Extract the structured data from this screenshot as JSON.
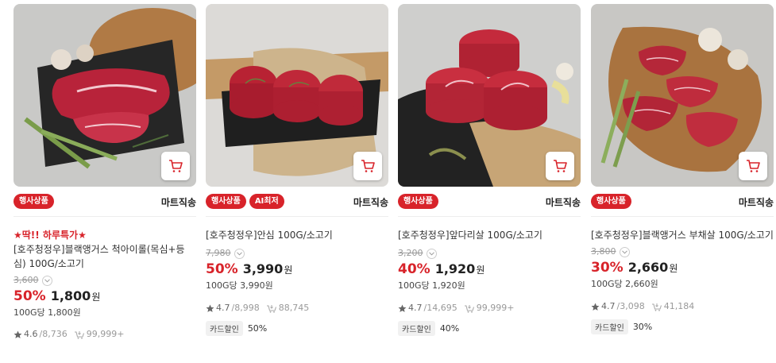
{
  "products": [
    {
      "badges": [
        "행사상품"
      ],
      "mart_label": "마트직송",
      "promo": "★딱!! 하루특가★",
      "title": "[호주청정우]블랙앵거스 척아이롤(목심+등심) 100G/소고기",
      "original_price": "3,600",
      "discount": "50%",
      "price": "1,800",
      "won": "원",
      "unit_price": "100G당 1,800원",
      "rating": "4.6",
      "reviews": "/8,736",
      "purchases": "99,999+",
      "card_discount_label": "",
      "card_discount_value": ""
    },
    {
      "badges": [
        "행사상품",
        "AI최저"
      ],
      "mart_label": "마트직송",
      "promo": "",
      "title": "[호주청정우]안심 100G/소고기",
      "original_price": "7,980",
      "discount": "50%",
      "price": "3,990",
      "won": "원",
      "unit_price": "100G당 3,990원",
      "rating": "4.7",
      "reviews": "/8,998",
      "purchases": "88,745",
      "card_discount_label": "카드할인",
      "card_discount_value": "50%"
    },
    {
      "badges": [
        "행사상품"
      ],
      "mart_label": "마트직송",
      "promo": "",
      "title": "[호주청정우]앞다리살 100G/소고기",
      "original_price": "3,200",
      "discount": "40%",
      "price": "1,920",
      "won": "원",
      "unit_price": "100G당 1,920원",
      "rating": "4.7",
      "reviews": "/14,695",
      "purchases": "99,999+",
      "card_discount_label": "카드할인",
      "card_discount_value": "40%"
    },
    {
      "badges": [
        "행사상품"
      ],
      "mart_label": "마트직송",
      "promo": "",
      "title": "[호주청정우]블랙앵거스 부채살 100G/소고기",
      "original_price": "3,800",
      "discount": "30%",
      "price": "2,660",
      "won": "원",
      "unit_price": "100G당 2,660원",
      "rating": "4.7",
      "reviews": "/3,098",
      "purchases": "41,184",
      "card_discount_label": "카드할인",
      "card_discount_value": "30%"
    }
  ],
  "icons": {
    "cart": "cart-icon",
    "star": "star-icon",
    "purchase": "basket-icon",
    "chevron": "chevron-down-icon"
  },
  "colors": {
    "accent": "#d8232a",
    "badge_text": "#ffffff"
  }
}
